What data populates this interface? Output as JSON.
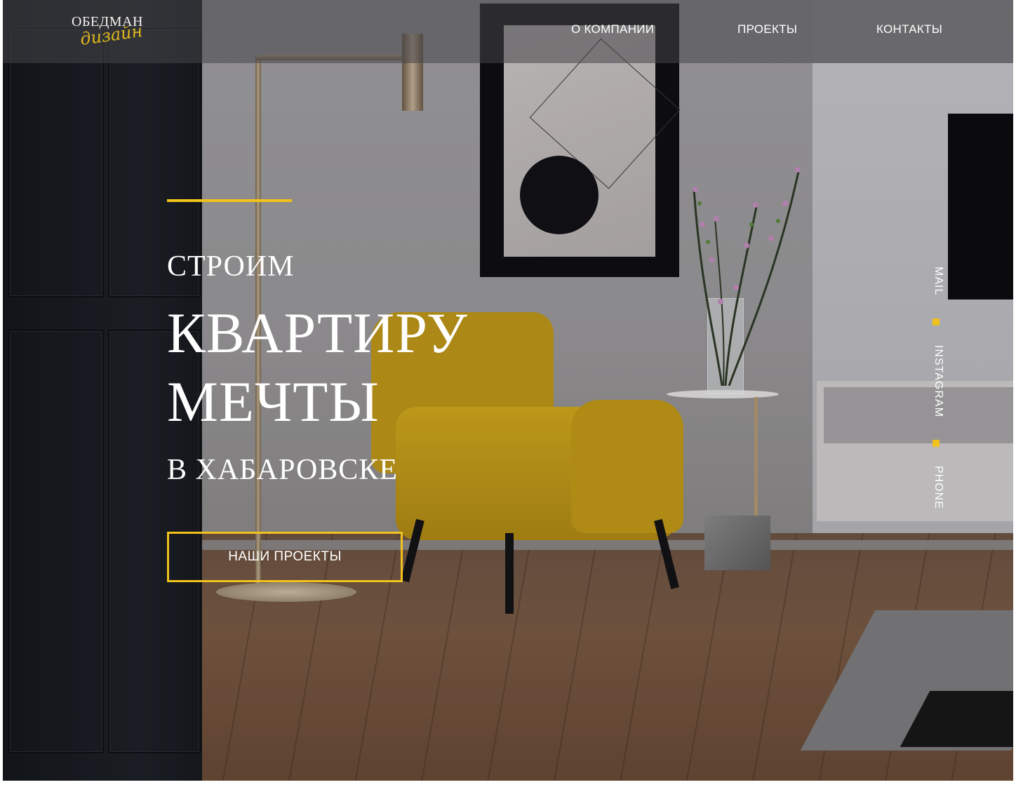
{
  "brand": {
    "name_top": "ОБЕДМАН",
    "name_script": "дизайн",
    "accent_color": "#f1c21b"
  },
  "nav": {
    "items": [
      "О КОМПАНИИ",
      "ПРОЕКТЫ",
      "КОНТАКТЫ"
    ]
  },
  "hero": {
    "line1": "СТРОИМ",
    "line2": "КВАРТИРУ",
    "line3": "МЕЧТЫ",
    "line4": "В ХАБАРОВСКЕ",
    "cta_label": "НАШИ ПРОЕКТЫ"
  },
  "side_links": [
    "MAIL",
    "INSTAGRAM",
    "PHONE"
  ]
}
